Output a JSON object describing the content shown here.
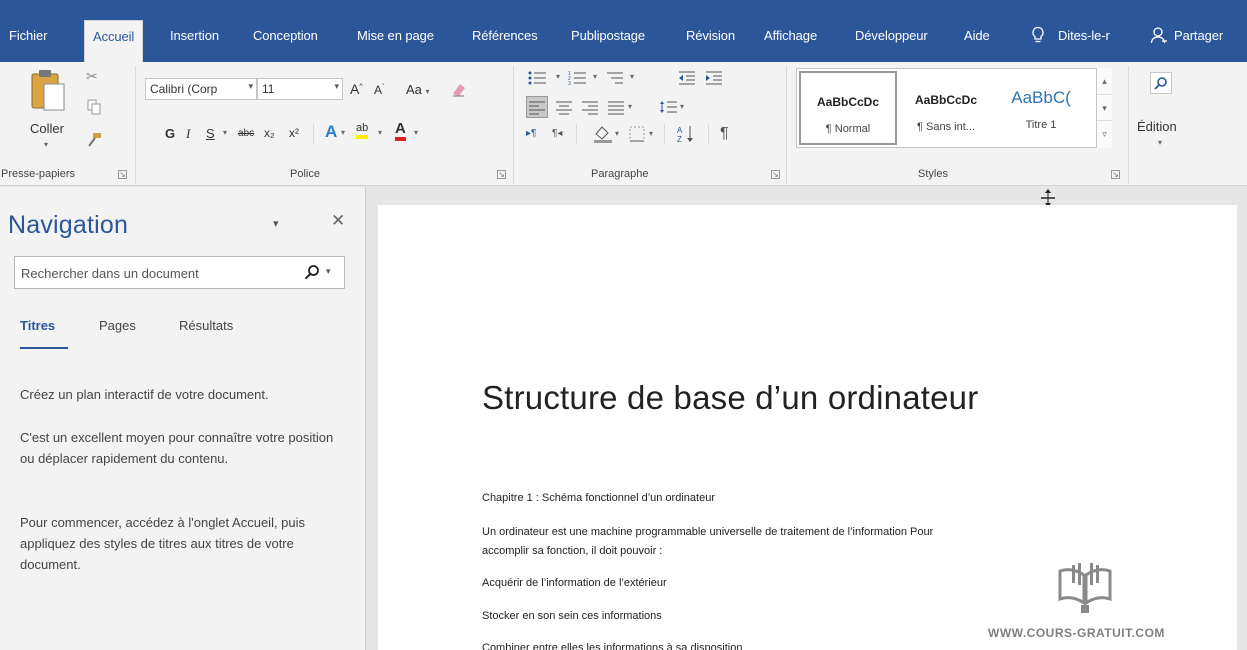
{
  "menu": {
    "tabs": [
      "Fichier",
      "Accueil",
      "Insertion",
      "Conception",
      "Mise en page",
      "Références",
      "Publipostage",
      "Révision",
      "Affichage",
      "Développeur",
      "Aide"
    ],
    "active_tab": "Accueil",
    "tell_me": "Dites-le-r",
    "share": "Partager"
  },
  "ribbon": {
    "clipboard": {
      "paste_label": "Coller",
      "group_label": "Presse-papiers"
    },
    "font": {
      "font_name": "Calibri (Corp",
      "font_size": "11",
      "case_label": "Aa",
      "bold": "G",
      "italic": "I",
      "underline": "S",
      "strikethrough": "abc",
      "subscript": "x₂",
      "superscript": "x²",
      "highlight": "ab",
      "font_color": "A",
      "group_label": "Police"
    },
    "paragraph": {
      "group_label": "Paragraphe"
    },
    "styles": {
      "items": [
        {
          "sample": "AaBbCcDc",
          "name": "¶ Normal"
        },
        {
          "sample": "AaBbCcDc",
          "name": "¶ Sans int..."
        },
        {
          "sample": "AaBbC(",
          "name": "Titre 1"
        }
      ],
      "group_label": "Styles"
    },
    "editing": {
      "label": "Édition"
    }
  },
  "navigation": {
    "title": "Navigation",
    "search_placeholder": "Rechercher dans un document",
    "tabs": [
      "Titres",
      "Pages",
      "Résultats"
    ],
    "active_tab": "Titres",
    "paragraphs": [
      "Créez un plan interactif de votre document.",
      "C'est un excellent moyen pour connaître votre position ou déplacer rapidement du contenu.",
      "Pour commencer, accédez à l'onglet Accueil, puis appliquez des styles de titres aux titres de votre document."
    ]
  },
  "document": {
    "title": "Structure de base d’un ordinateur",
    "paragraphs": [
      "Chapitre 1 : Schéma fonctionnel d’un ordinateur",
      "Un ordinateur est une machine programmable universelle de traitement de l’information Pour",
      "accomplir sa fonction, il doit pouvoir :",
      "Acquérir de l’information de l’extérieur",
      "Stocker en son sein ces informations",
      "Combiner entre elles les informations à sa disposition"
    ],
    "watermark": "WWW.COURS-GRATUIT.COM"
  },
  "colors": {
    "accent": "#2b579a",
    "ribbon_bg": "#f3f3f3"
  }
}
